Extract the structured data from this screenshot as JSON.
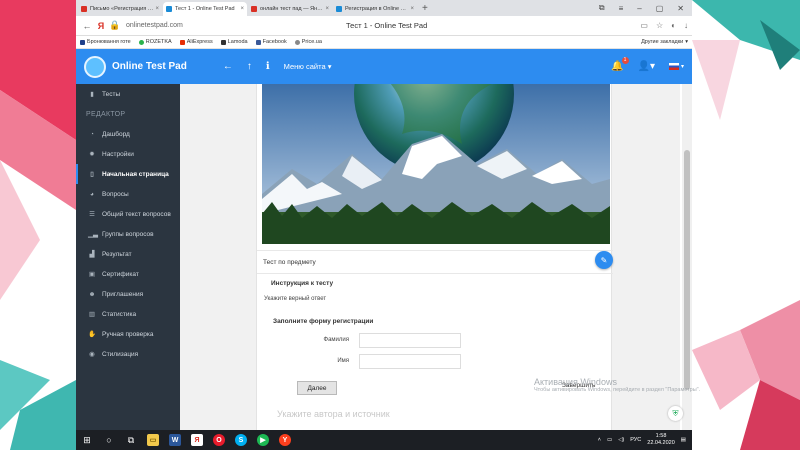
{
  "browser": {
    "tabs": [
      {
        "label": "Письмо «Регистрация в О",
        "color": "#d93025",
        "active": false
      },
      {
        "label": "Тест 1 - Online Test Pad",
        "color": "#1a8bd6",
        "active": true
      },
      {
        "label": "онлайн тест пад — Яндек",
        "color": "#d93025",
        "active": false
      },
      {
        "label": "Регистрация в Online Test",
        "color": "#1a8bd6",
        "active": false
      }
    ],
    "url": "onlinetestpad.com",
    "page_title": "Тест 1 - Online Test Pad",
    "bookmarks": [
      {
        "label": "Бронювання готе",
        "color": "#1e3f8a"
      },
      {
        "label": "ROZETKA",
        "color": "#2bb24c"
      },
      {
        "label": "AliExpress",
        "color": "#e62e04"
      },
      {
        "label": "Lamoda",
        "color": "#333333"
      },
      {
        "label": "Facebook",
        "color": "#3b5998"
      },
      {
        "label": "Price.ua",
        "color": "#888888"
      }
    ],
    "other_bookmarks": "Другие закладки"
  },
  "app": {
    "brand": "Online Test Pad",
    "site_menu": "Меню сайта",
    "notification_count": "1",
    "accent": "#2d8cf0"
  },
  "sidebar": {
    "tests": "Тесты",
    "section": "РЕДАКТОР",
    "items": [
      {
        "label": "Дашборд",
        "icon": "dashboard-icon"
      },
      {
        "label": "Настройки",
        "icon": "gear-icon"
      },
      {
        "label": "Начальная страница",
        "icon": "document-icon"
      },
      {
        "label": "Вопросы",
        "icon": "question-icon"
      },
      {
        "label": "Общий текст вопросов",
        "icon": "text-icon"
      },
      {
        "label": "Группы вопросов",
        "icon": "bars-icon"
      },
      {
        "label": "Результат",
        "icon": "chart-icon"
      },
      {
        "label": "Сертификат",
        "icon": "certificate-icon"
      },
      {
        "label": "Приглашения",
        "icon": "users-icon"
      },
      {
        "label": "Статистика",
        "icon": "stats-icon"
      },
      {
        "label": "Ручная проверка",
        "icon": "hand-icon"
      },
      {
        "label": "Стилизация",
        "icon": "palette-icon"
      }
    ]
  },
  "content": {
    "subject": "Тест по предмету",
    "instructions_title": "Инструкция к тесту",
    "instructions_text": "Укажите верный ответ",
    "form_title": "Заполните форму регистрации",
    "lastname_label": "Фамилия",
    "firstname_label": "Имя",
    "next_button": "Далее",
    "finish_button": "Завершить",
    "faint_caption": "Укажите автора и источник"
  },
  "windows_notice": {
    "title": "Активация Windows",
    "text": "Чтобы активировать Windows, перейдите в раздел \"Параметры\"."
  },
  "taskbar": {
    "lang": "РУС",
    "time": "1:58",
    "date": "22.04.2020"
  }
}
